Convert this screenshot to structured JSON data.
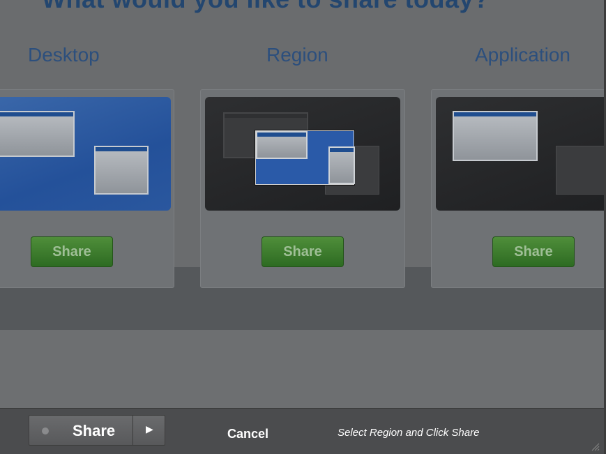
{
  "headline": "What would you like to share today?",
  "columns": [
    {
      "label": "Desktop",
      "button": "Share"
    },
    {
      "label": "Region",
      "button": "Share"
    },
    {
      "label": "Application",
      "button": "Share"
    }
  ],
  "toolbar": {
    "share_label": "Share",
    "cancel_label": "Cancel",
    "hint": "Select Region and Click Share"
  },
  "icons": {
    "record_dot": "record-dot-icon",
    "arrow": "triangle-right-icon",
    "resize": "resize-grip-icon"
  },
  "colors": {
    "share_green": "#3f7e2e",
    "accent_blue": "#2a5aa8",
    "heading_blue": "#2c4f7d"
  }
}
